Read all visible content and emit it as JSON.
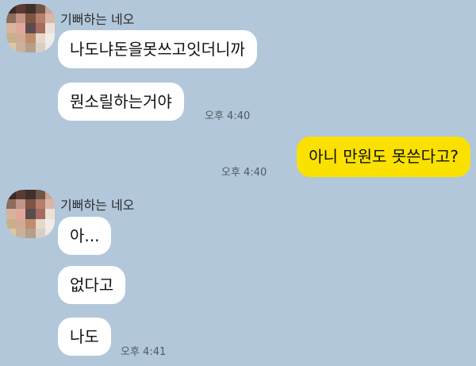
{
  "chat": {
    "background_color": "#b2c7da",
    "incoming_bubble_color": "#ffffff",
    "outgoing_bubble_color": "#fae100",
    "groups": [
      {
        "sender": "기뻐하는 네오",
        "avatar": "pixelated-profile-photo",
        "messages": [
          {
            "text": "나도냐돈을못쓰고잇더니까"
          },
          {
            "text": "뭔소릴하는거야",
            "time": "오후 4:40"
          }
        ]
      },
      {
        "outgoing": true,
        "messages": [
          {
            "text": "아니 만원도 못쓴다고?",
            "time": "오후 4:40"
          }
        ]
      },
      {
        "sender": "기뻐하는 네오",
        "avatar": "pixelated-profile-photo",
        "messages": [
          {
            "text": "아..."
          },
          {
            "text": "없다고"
          },
          {
            "text": "나도",
            "time": "오후 4:41"
          }
        ]
      }
    ]
  }
}
